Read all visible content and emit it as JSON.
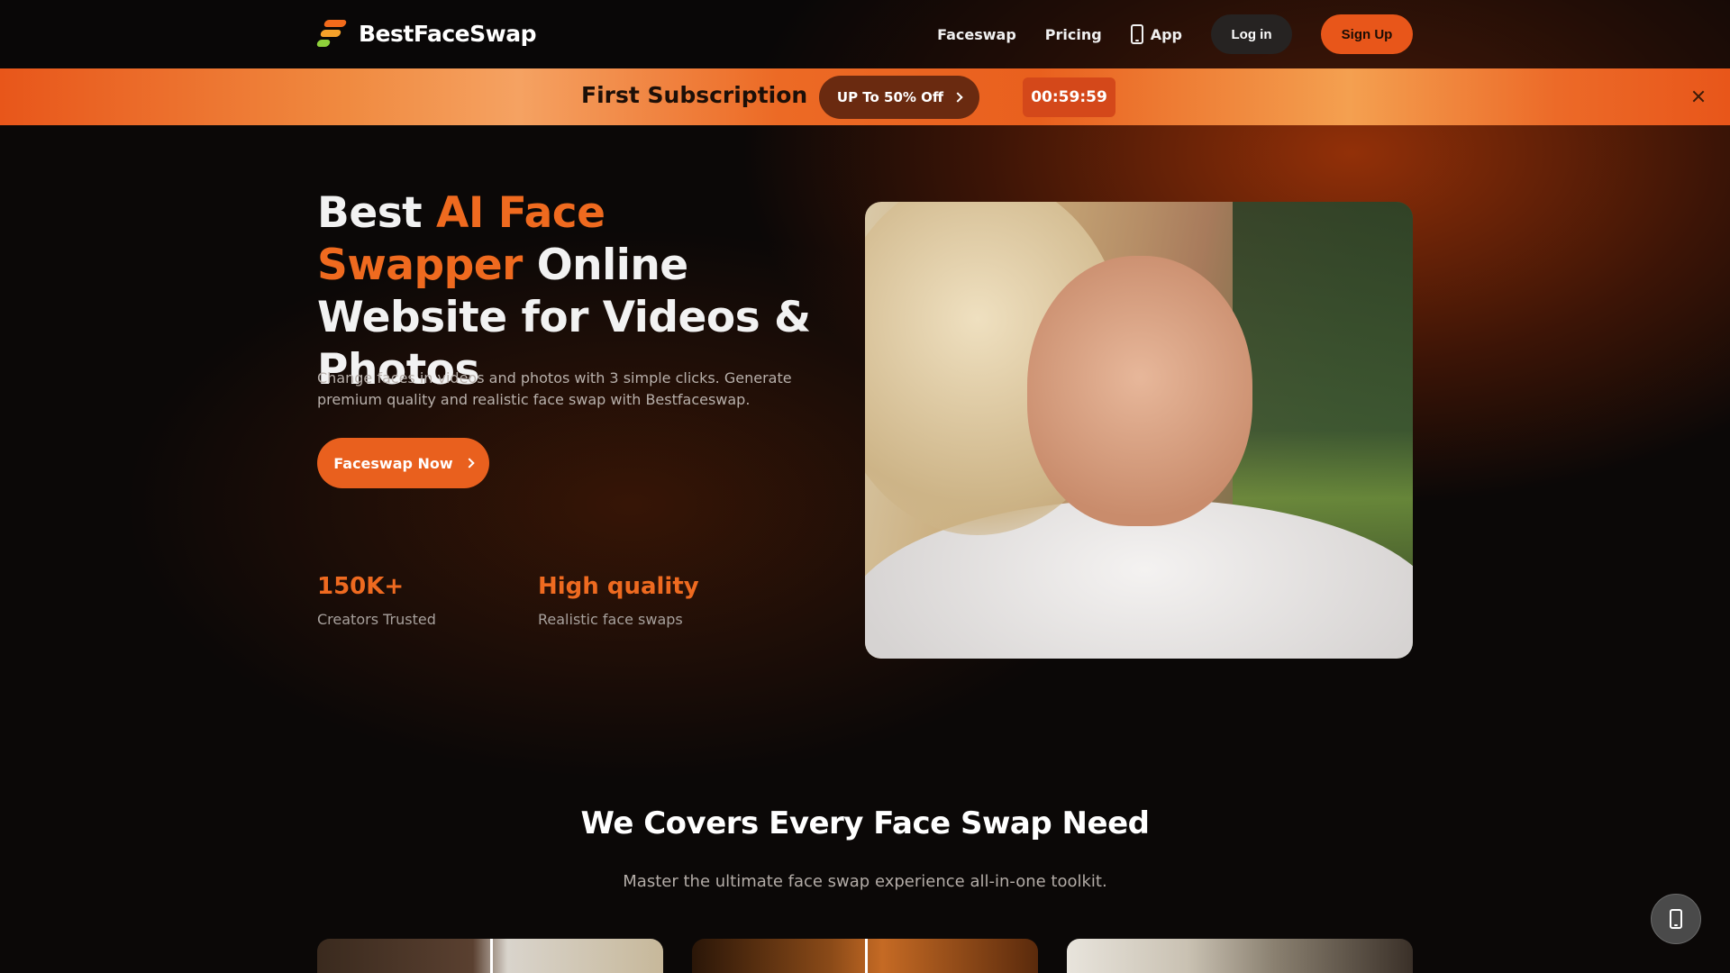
{
  "brand": {
    "name": "BestFaceSwap"
  },
  "nav": {
    "links": [
      "Faceswap",
      "Pricing",
      "App"
    ],
    "login_label": "Log in",
    "signup_label": "Sign Up"
  },
  "promo": {
    "title": "First Subscription",
    "button_label": "UP To 50% Off",
    "timer": "00:59:59"
  },
  "hero": {
    "title_part1": "Best ",
    "title_accent": "AI Face Swapper",
    "title_part2": "Online Website for Videos & Photos",
    "description": "Change faces in videos and photos with 3 simple clicks. Generate premium quality and realistic face swap with Bestfaceswap.",
    "cta_label": "Faceswap Now",
    "stats": [
      {
        "value": "150K+",
        "label": "Creators Trusted"
      },
      {
        "value": "High quality",
        "label": "Realistic face swaps"
      }
    ]
  },
  "section": {
    "title": "We Covers Every Face Swap Need",
    "subtitle": "Master the ultimate face swap experience all-in-one toolkit."
  },
  "colors": {
    "accent": "#ef6a1f",
    "background": "#0b0807",
    "promo_button": "#6a2a10"
  },
  "icons": [
    "logo-icon",
    "phone-icon",
    "chevron-right-icon",
    "close-icon"
  ]
}
